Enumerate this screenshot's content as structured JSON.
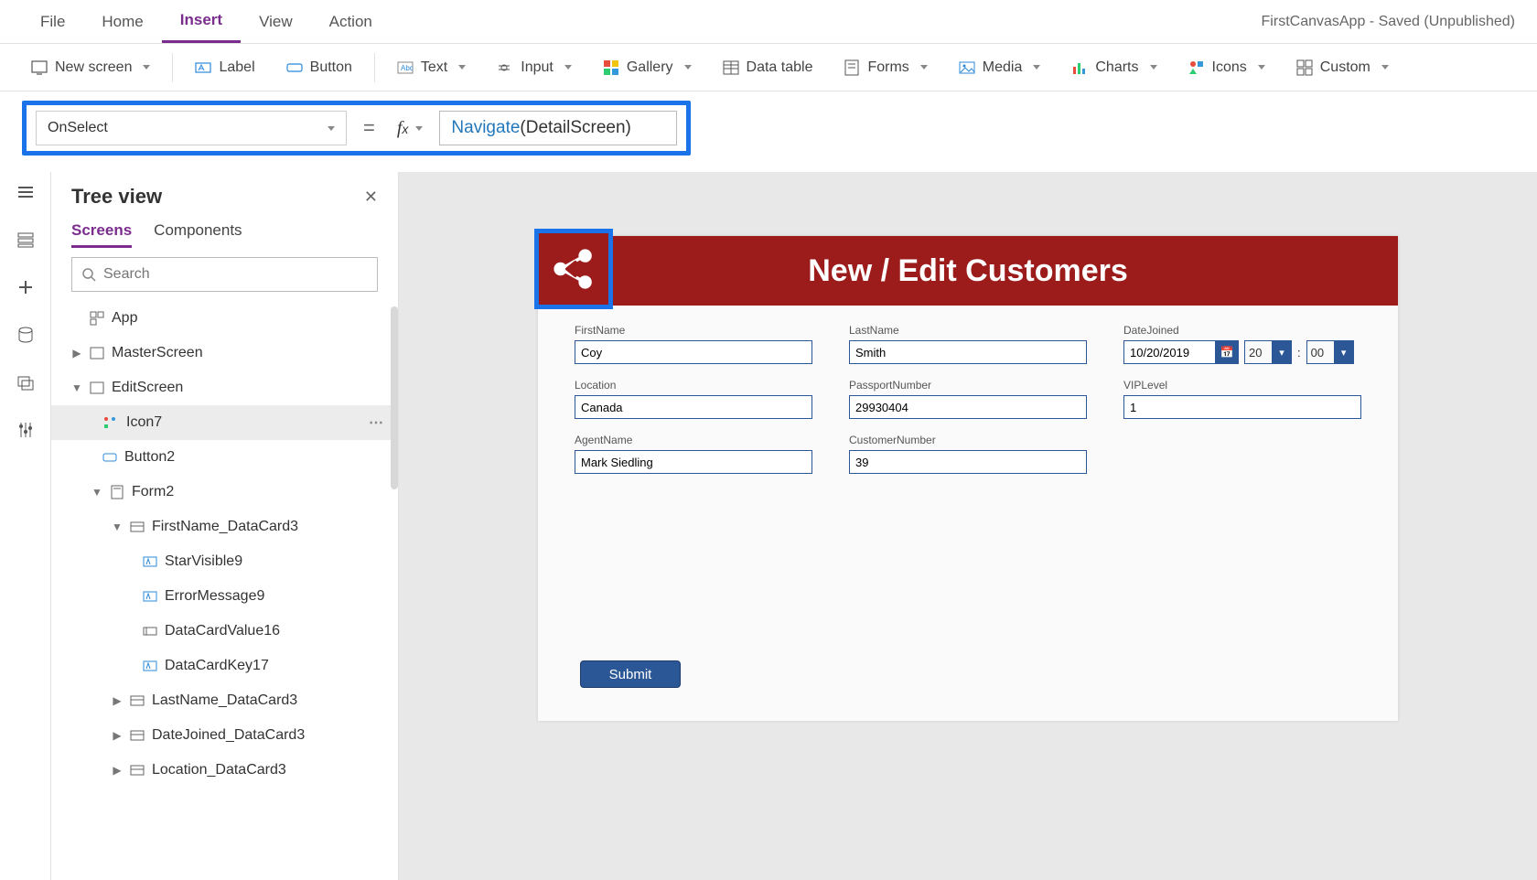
{
  "app_title": "FirstCanvasApp - Saved (Unpublished)",
  "topmenu": [
    "File",
    "Home",
    "Insert",
    "View",
    "Action"
  ],
  "topmenu_active": "Insert",
  "ribbon": {
    "newscreen": "New screen",
    "label": "Label",
    "button": "Button",
    "text": "Text",
    "input": "Input",
    "gallery": "Gallery",
    "datatable": "Data table",
    "forms": "Forms",
    "media": "Media",
    "charts": "Charts",
    "icons": "Icons",
    "custom": "Custom"
  },
  "formula": {
    "property": "OnSelect",
    "fn": "Navigate",
    "arg": "(DetailScreen)"
  },
  "tree": {
    "title": "Tree view",
    "tabs": [
      "Screens",
      "Components"
    ],
    "tabs_active": "Screens",
    "search_placeholder": "Search",
    "nodes": {
      "app": "App",
      "master": "MasterScreen",
      "edit": "EditScreen",
      "icon7": "Icon7",
      "button2": "Button2",
      "form2": "Form2",
      "fn_dc": "FirstName_DataCard3",
      "sv9": "StarVisible9",
      "em9": "ErrorMessage9",
      "dcv16": "DataCardValue16",
      "dck17": "DataCardKey17",
      "ln_dc": "LastName_DataCard3",
      "dj_dc": "DateJoined_DataCard3",
      "loc_dc": "Location_DataCard3"
    }
  },
  "screen": {
    "title": "New / Edit Customers",
    "labels": {
      "firstname": "FirstName",
      "lastname": "LastName",
      "datejoined": "DateJoined",
      "location": "Location",
      "passport": "PassportNumber",
      "vip": "VIPLevel",
      "agent": "AgentName",
      "custnum": "CustomerNumber"
    },
    "values": {
      "firstname": "Coy",
      "lastname": "Smith",
      "date": "10/20/2019",
      "hour": "20",
      "minute": "00",
      "location": "Canada",
      "passport": "29930404",
      "vip": "1",
      "agent": "Mark Siedling",
      "custnum": "39"
    },
    "submit": "Submit"
  }
}
